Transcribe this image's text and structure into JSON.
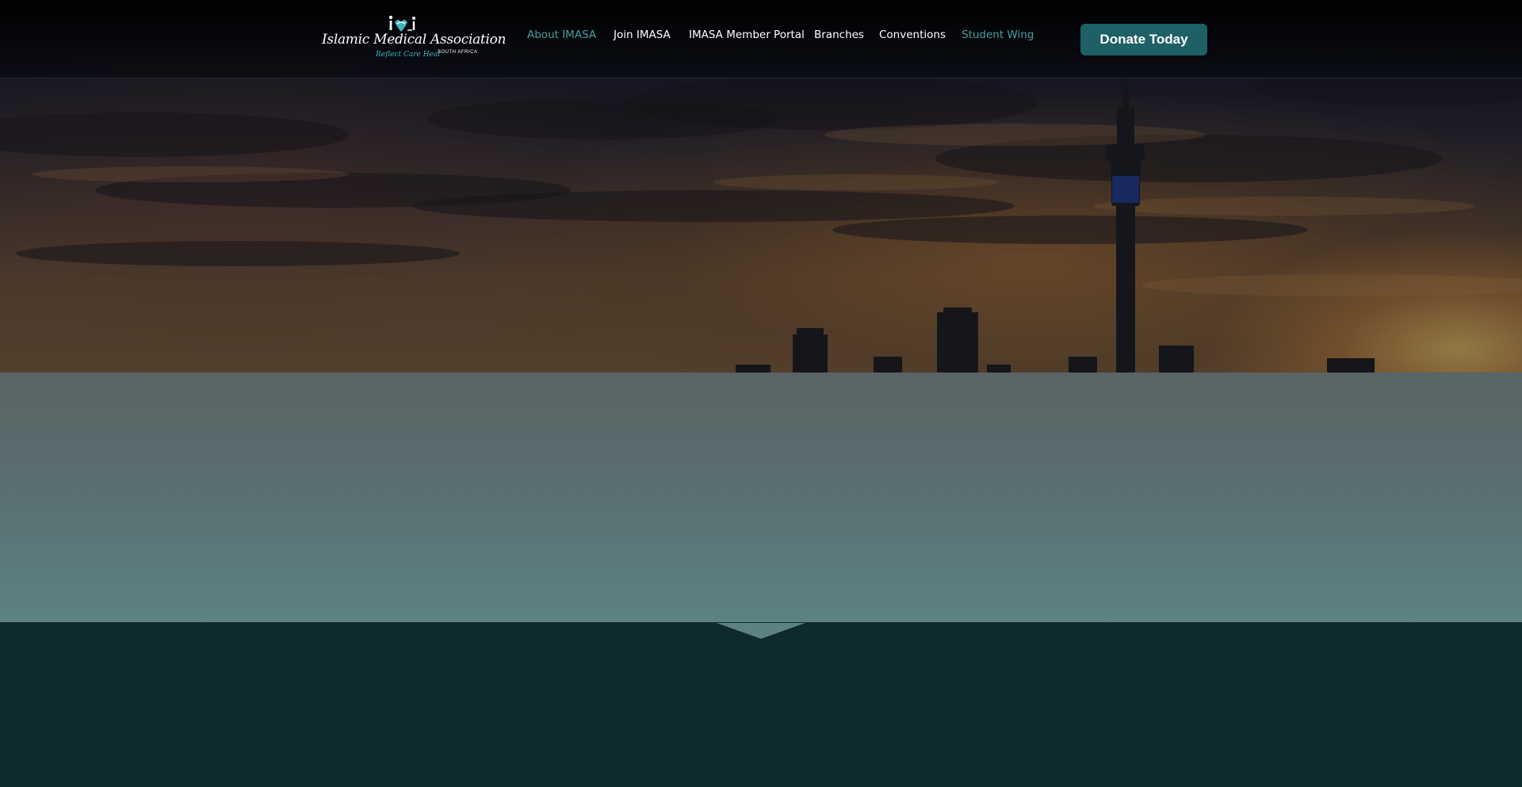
{
  "header": {
    "logo": {
      "name": "Islamic Medical Association",
      "region": "SOUTH AFRICA",
      "tagline": "Reflect Care Heal",
      "mark": "i·a"
    },
    "nav": [
      {
        "label": "About IMASA",
        "style": "accent"
      },
      {
        "label": "Join IMASA",
        "style": "normal"
      },
      {
        "label": "IMASA Member Portal",
        "style": "normal"
      },
      {
        "label": "Branches",
        "style": "normal"
      },
      {
        "label": "Conventions",
        "style": "normal"
      },
      {
        "label": "Student Wing",
        "style": "accent"
      }
    ],
    "donate_label": "Donate Today"
  },
  "colors": {
    "accent_text": "#4a9fa0",
    "donate_bg": "#1f5f66",
    "dark_section": "#0f2a2e",
    "teal_band": "#5c8284",
    "tagline": "#3fb6c2"
  },
  "icons": {
    "logo_mark": "imasa-logo-mark-icon"
  }
}
